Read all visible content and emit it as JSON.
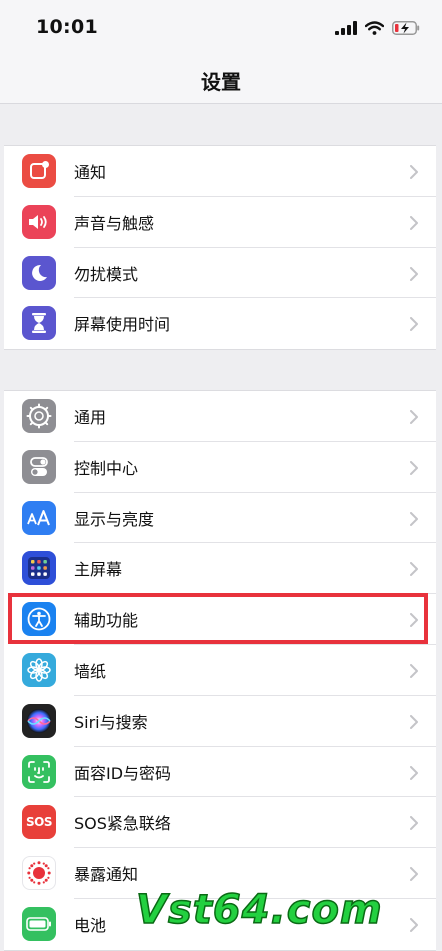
{
  "status_bar": {
    "time": "10:01",
    "icons": [
      "cellular-signal-icon",
      "wifi-icon",
      "battery-low-charging-icon"
    ]
  },
  "header": {
    "title": "设置"
  },
  "groups": [
    {
      "items": [
        {
          "label": "通知",
          "icon": "notifications-icon",
          "color": "#eb4c43"
        },
        {
          "label": "声音与触感",
          "icon": "speaker-icon",
          "color": "#eb4358"
        },
        {
          "label": "勿扰模式",
          "icon": "moon-icon",
          "color": "#5b56cf"
        },
        {
          "label": "屏幕使用时间",
          "icon": "hourglass-icon",
          "color": "#5b56cf"
        }
      ]
    },
    {
      "items": [
        {
          "label": "通用",
          "icon": "gear-icon",
          "color": "#8e8e93"
        },
        {
          "label": "控制中心",
          "icon": "toggles-icon",
          "color": "#8e8e93"
        },
        {
          "label": "显示与亮度",
          "icon": "text-size-icon",
          "color": "#2f7ef2"
        },
        {
          "label": "主屏幕",
          "icon": "home-screen-grid-icon",
          "color": "#2e4fd8"
        },
        {
          "label": "辅助功能",
          "icon": "accessibility-icon",
          "color": "#1a82f0"
        },
        {
          "label": "墙纸",
          "icon": "flower-icon",
          "color": "#35aadc"
        },
        {
          "label": "Siri与搜索",
          "icon": "siri-icon",
          "color": "#222222"
        },
        {
          "label": "面容ID与密码",
          "icon": "face-id-icon",
          "color": "#34c060"
        },
        {
          "label": "SOS紧急联络",
          "icon": "sos-icon",
          "color": "#e8403a"
        },
        {
          "label": "暴露通知",
          "icon": "exposure-icon",
          "color": "#ffffff"
        },
        {
          "label": "电池",
          "icon": "battery-icon",
          "color": "#34c060"
        }
      ]
    }
  ],
  "highlighted_item": "辅助功能",
  "watermark": "Vst64.com",
  "accent": {
    "highlight_border": "#e8323c",
    "chevron": "#c4c4c8"
  }
}
